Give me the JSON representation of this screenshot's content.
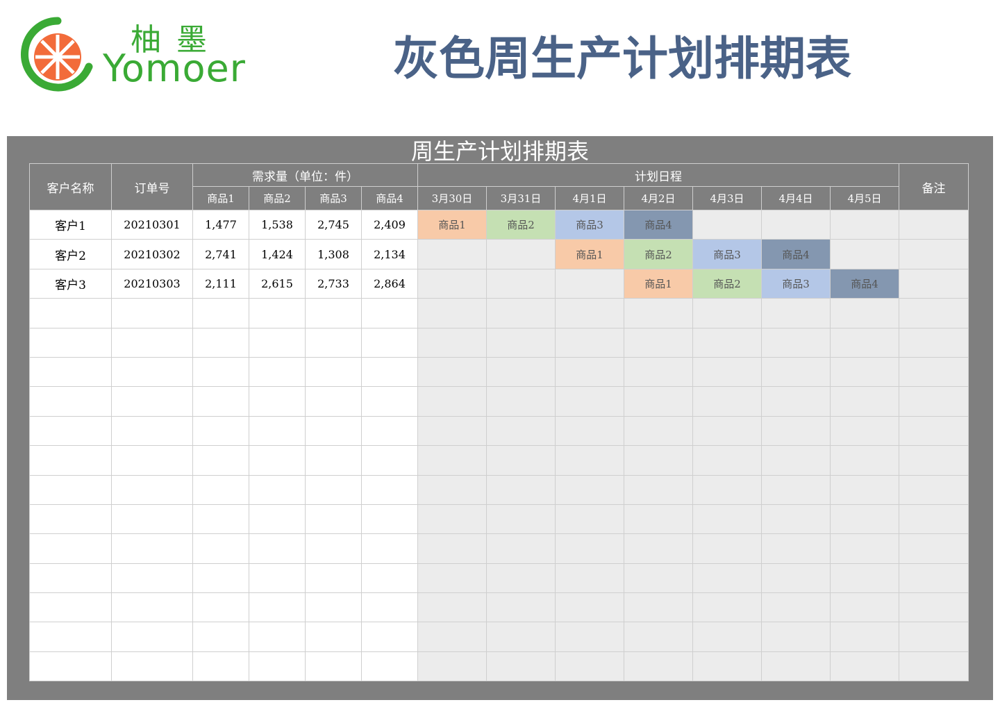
{
  "brand": {
    "cn": "柚墨",
    "en": "Yomoer"
  },
  "title": "灰色周生产计划排期表",
  "sheet": {
    "title": "周生产计划排期表",
    "headers": {
      "customer": "客户名称",
      "order": "订单号",
      "demand": "需求量（单位：件）",
      "schedule": "计划日程",
      "remark": "备注",
      "products": [
        "商品1",
        "商品2",
        "商品3",
        "商品4"
      ],
      "dates": [
        "3月30日",
        "3月31日",
        "4月1日",
        "4月2日",
        "4月3日",
        "4月4日",
        "4月5日"
      ]
    },
    "rows": [
      {
        "customer": "客户1",
        "order": "20210301",
        "qty": [
          "1,477",
          "1,538",
          "2,745",
          "2,409"
        ],
        "schedule": [
          "商品1",
          "商品2",
          "商品3",
          "商品4",
          "",
          "",
          ""
        ]
      },
      {
        "customer": "客户2",
        "order": "20210302",
        "qty": [
          "2,741",
          "1,424",
          "1,308",
          "2,134"
        ],
        "schedule": [
          "",
          "",
          "商品1",
          "商品2",
          "商品3",
          "商品4",
          ""
        ]
      },
      {
        "customer": "客户3",
        "order": "20210303",
        "qty": [
          "2,111",
          "2,615",
          "2,733",
          "2,864"
        ],
        "schedule": [
          "",
          "",
          "",
          "商品1",
          "商品2",
          "商品3",
          "商品4"
        ]
      }
    ],
    "empty_rows": 13
  },
  "colors": {
    "brand_green": "#3aaa35",
    "title_blue": "#4a6287",
    "panel_gray": "#7f7f7f",
    "product_colors": {
      "商品1": "#f8caa8",
      "商品2": "#c5e0b3",
      "商品3": "#b4c7e7",
      "商品4": "#8497b0"
    }
  }
}
